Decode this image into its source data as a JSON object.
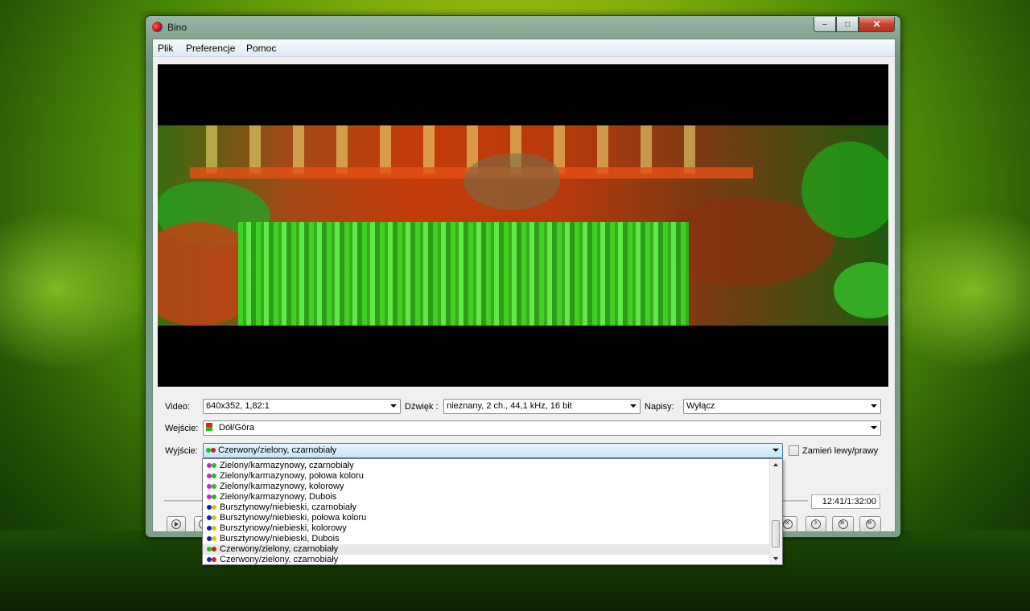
{
  "window": {
    "title": "Bino"
  },
  "menu": [
    "Plik",
    "Preferencje",
    "Pomoc"
  ],
  "controls": {
    "video_label": "Video:",
    "video_value": "640x352, 1,82:1",
    "audio_label": "Dźwięk :",
    "audio_value": "nieznany, 2 ch., 44,1 kHz, 16 bit",
    "subs_label": "Napisy:",
    "subs_value": "Wyłącz",
    "input_label": "Wejście:",
    "input_value": "Dół/Góra",
    "output_label": "Wyjście:",
    "output_value": "Czerwony/zielony, czarnobiały",
    "swap_label": "Zamień lewy/prawy",
    "swap_checked": false,
    "time": "12:41/1:32:00"
  },
  "dropdown": {
    "items": [
      {
        "label": "Zielony/karmazynowy, czarnobiały",
        "c1": "#d020d0",
        "c2": "#20c020"
      },
      {
        "label": "Zielony/karmazynowy, połowa koloru",
        "c1": "#d020d0",
        "c2": "#20c020"
      },
      {
        "label": "Zielony/karmazynowy, kolorowy",
        "c1": "#d020d0",
        "c2": "#20c020"
      },
      {
        "label": "Zielony/karmazynowy, Dubois",
        "c1": "#d020d0",
        "c2": "#20c020"
      },
      {
        "label": "Bursztynowy/niebieski, czarnobiały",
        "c1": "#1020c0",
        "c2": "#e0c000"
      },
      {
        "label": "Bursztynowy/niebieski,  połowa koloru",
        "c1": "#1020c0",
        "c2": "#e0c000"
      },
      {
        "label": "Bursztynowy/niebieski, kolorowy",
        "c1": "#1020c0",
        "c2": "#e0c000"
      },
      {
        "label": "Bursztynowy/niebieski, Dubois",
        "c1": "#1020c0",
        "c2": "#e0c000"
      },
      {
        "label": "Czerwony/zielony, czarnobiały",
        "c1": "#20c020",
        "c2": "#d02020",
        "highlighted": true
      },
      {
        "label": "Czerwony/zielony, czarnobiały",
        "c1": "#1020c0",
        "c2": "#d02020"
      }
    ]
  },
  "icons": {
    "app": "bino-app-icon",
    "transport": [
      "play-icon",
      "pause-icon",
      "rewind-icon",
      "step-icon",
      "fast-forward-icon",
      "fast-forward-end-icon"
    ]
  }
}
